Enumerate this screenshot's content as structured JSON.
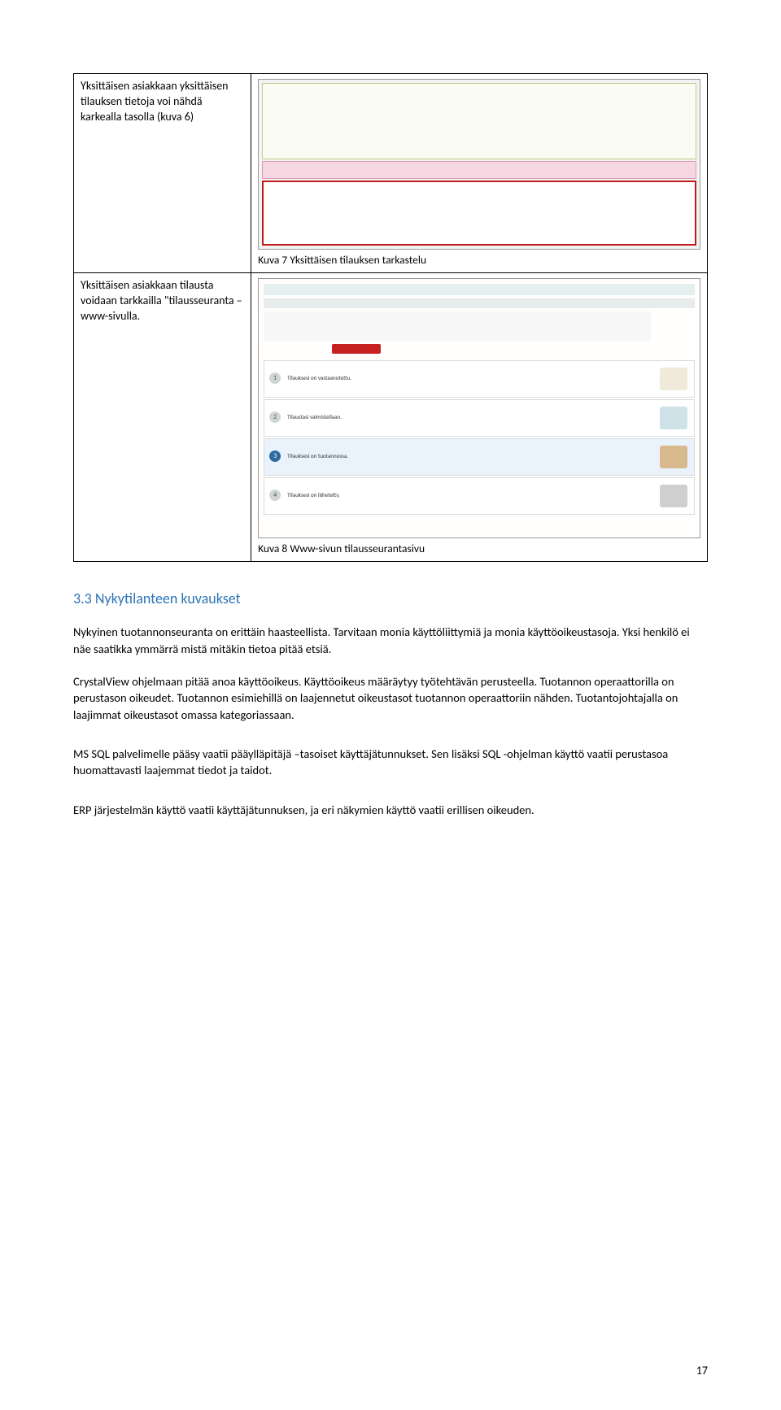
{
  "table_rows": [
    {
      "left": "Yksittäisen asiakkaan yksittäisen tilauksen tietoja voi nähdä karkealla tasolla (kuva 6)",
      "caption": "Kuva 7 Yksittäisen tilauksen tarkastelu"
    },
    {
      "left": "Yksittäisen asiakkaan tilausta voidaan tarkkailla \"tilausseuranta – www-sivulla.",
      "caption": "Kuva 8 Www-sivun tilausseurantasivu"
    }
  ],
  "fig2_steps": {
    "s1": "Tilauksesi on vastaanotettu.",
    "s2": "Tilaustasi valmistellaan.",
    "s3": "Tilauksesi on tuotannossa.",
    "s4": "Tilauksesi on lähetetty."
  },
  "section_heading": "3.3 Nykytilanteen kuvaukset",
  "paragraphs": {
    "p1": "Nykyinen tuotannonseuranta on erittäin haasteellista. Tarvitaan monia käyttöliittymiä ja monia käyttöoikeustasoja. Yksi henkilö ei näe saatikka ymmärrä mistä mitäkin tietoa pitää etsiä.",
    "p2": "CrystalView ohjelmaan pitää anoa käyttöoikeus. Käyttöoikeus määräytyy työtehtävän perusteella. Tuotannon operaattorilla on perustason oikeudet. Tuotannon esimiehillä on laajennetut oikeustasot tuotannon operaattoriin nähden. Tuotantojohtajalla on laajimmat oikeustasot omassa kategoriassaan.",
    "p3": "MS SQL palvelimelle pääsy vaatii pääylläpitäjä –tasoiset käyttäjätunnukset. Sen lisäksi SQL -ohjelman käyttö vaatii perustasoa huomattavasti laajemmat tiedot ja taidot.",
    "p4": "ERP järjestelmän käyttö vaatii käyttäjätunnuksen, ja eri näkymien käyttö vaatii erillisen oikeuden."
  },
  "page_number": "17"
}
